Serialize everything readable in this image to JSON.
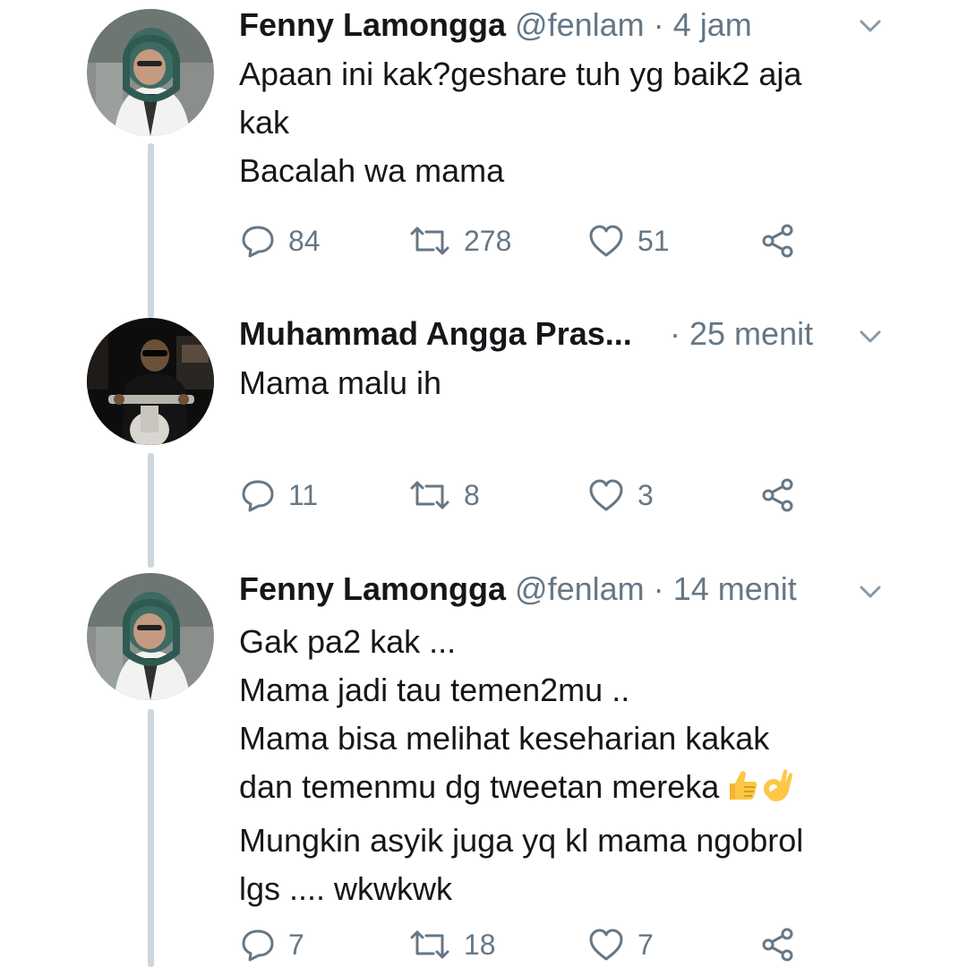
{
  "tweets": [
    {
      "name": "Fenny Lamongga",
      "handle": "@fenlam",
      "separator": "·",
      "time": "4 jam",
      "lines": [
        "Apaan ini kak?geshare tuh yg baik2 aja",
        "kak",
        "Bacalah wa mama"
      ],
      "replies": "84",
      "retweets": "278",
      "likes": "51",
      "avatar_icon": "avatar-hijab-labcoat"
    },
    {
      "name": "Muhammad Angga Pras...",
      "handle": "",
      "separator": "·",
      "time": "25 menit",
      "lines": [
        "Mama malu ih"
      ],
      "replies": "11",
      "retweets": "8",
      "likes": "3",
      "avatar_icon": "avatar-man-scooter"
    },
    {
      "name": "Fenny Lamongga",
      "handle": "@fenlam",
      "separator": "·",
      "time": "14 menit",
      "lines": [
        "Gak pa2 kak ...",
        "Mama jadi tau temen2mu ..",
        "Mama bisa melihat keseharian kakak",
        "dan temenmu dg tweetan mereka",
        "Mungkin asyik juga yq kl mama ngobrol",
        "lgs .... wkwkwk"
      ],
      "emoji": [
        "thumbs-up-emoji",
        "ok-hand-emoji"
      ],
      "replies": "7",
      "retweets": "18",
      "likes": "7",
      "avatar_icon": "avatar-hijab-labcoat"
    }
  ],
  "icons": {
    "reply": "reply-icon",
    "retweet": "retweet-icon",
    "like": "heart-icon",
    "share": "share-icon",
    "caret": "chevron-down-icon"
  },
  "colors": {
    "text": "#14171a",
    "secondary": "#657786",
    "thread_line": "#ccd6dd",
    "background": "#ffffff"
  }
}
